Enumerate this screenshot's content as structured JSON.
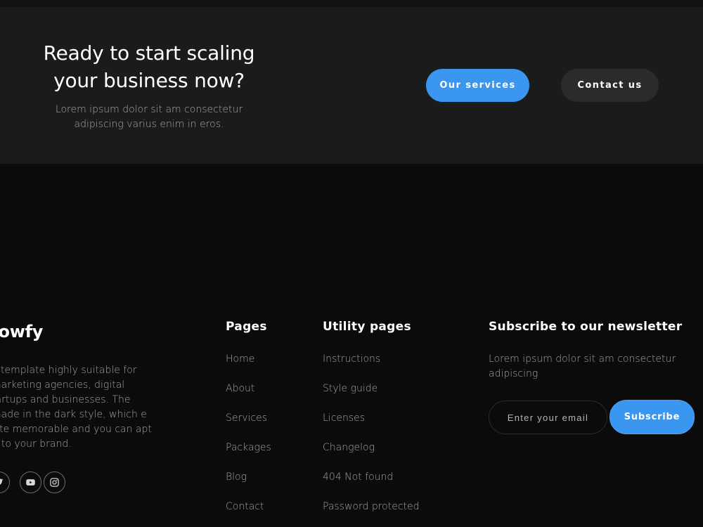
{
  "cta": {
    "title": "Ready to start scaling your business now?",
    "text": "Lorem ipsum dolor sit am consectetur adipiscing varius enim in eros.",
    "primary_button": "Our services",
    "secondary_button": "Contact us"
  },
  "brand": {
    "name": "rowfy",
    "description": "a template highly suitable for marketing agencies, digital tartups and businesses. The made in the dark style, which e site memorable and you can apt it to your brand."
  },
  "social": [
    "twitter-icon",
    "youtube-icon",
    "instagram-icon"
  ],
  "pages": {
    "title": "Pages",
    "links": [
      "Home",
      "About",
      "Services",
      "Packages",
      "Blog",
      "Contact"
    ]
  },
  "utility": {
    "title": "Utility pages",
    "links": [
      "Instructions",
      "Style guide",
      "Licenses",
      "Changelog",
      "404 Not found",
      "Password protected"
    ]
  },
  "newsletter": {
    "title": "Subscribe to our newsletter",
    "text": "Lorem ipsum dolor sit am consectetur adipiscing",
    "placeholder": "Enter your email",
    "button": "Subscribe"
  },
  "colors": {
    "accent": "#3b96f0",
    "background": "#0b0b0b",
    "panel": "#1b1b1b",
    "secondary_button": "#2b2b2b"
  }
}
